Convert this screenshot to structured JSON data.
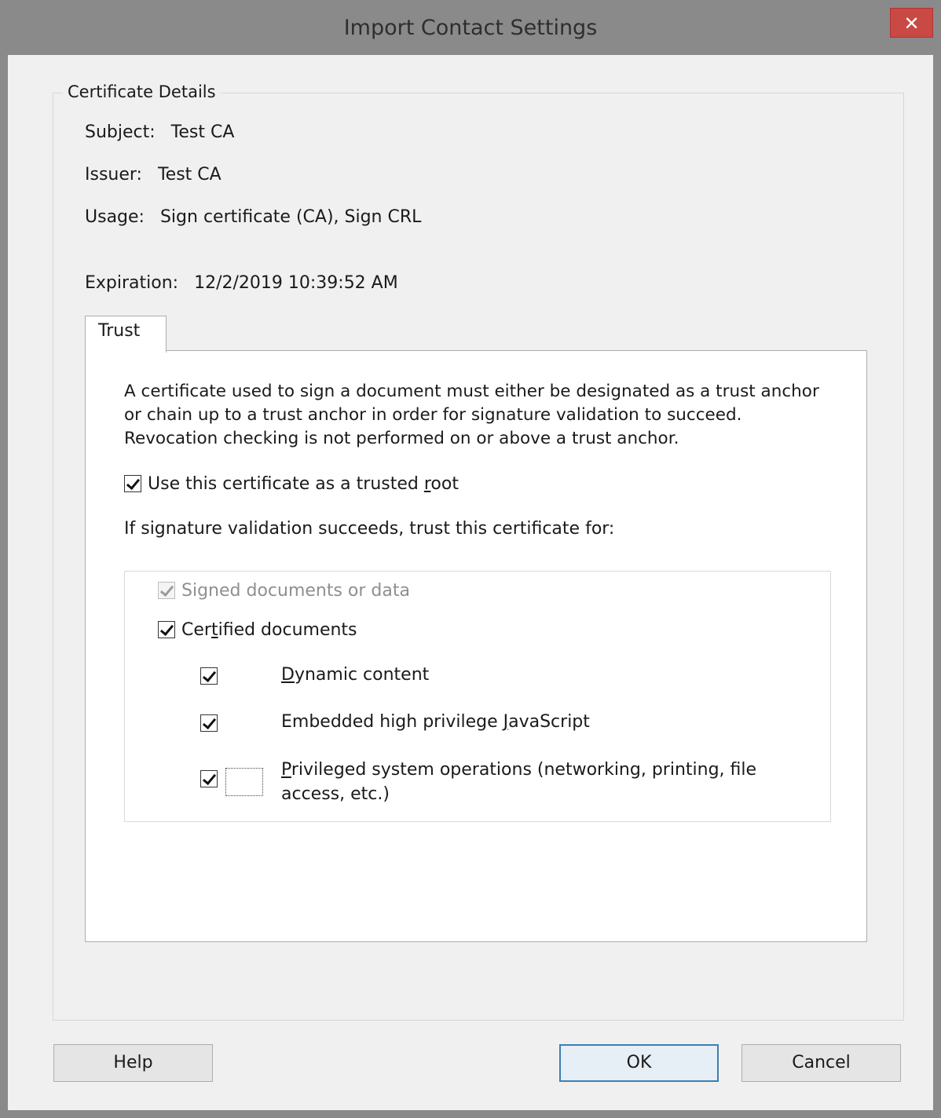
{
  "window": {
    "title": "Import Contact Settings",
    "close_glyph": "✕"
  },
  "group": {
    "title": "Certificate Details"
  },
  "details": {
    "subject_label": "Subject:",
    "subject_value": "Test CA",
    "issuer_label": "Issuer:",
    "issuer_value": "Test CA",
    "usage_label": "Usage:",
    "usage_value": "Sign certificate (CA), Sign CRL",
    "expiration_label": "Expiration:",
    "expiration_value": "12/2/2019 10:39:52 AM"
  },
  "tabs": [
    {
      "label": "Trust",
      "selected": true
    }
  ],
  "trust": {
    "description": "A certificate used to sign a document must either be designated as a trust anchor or chain up to a trust anchor in order for signature validation to succeed.  Revocation checking is not performed on or above a trust anchor.",
    "use_as_root": {
      "label_pre": "Use this certificate as a trusted ",
      "label_access": "r",
      "label_post": "oot",
      "checked": true
    },
    "trust_for_label": "If signature validation succeeds, trust this certificate for:",
    "options": {
      "signed_docs": {
        "label": "Signed documents or data",
        "checked": true,
        "enabled": false
      },
      "certified_docs": {
        "label_pre": "Cer",
        "label_access": "t",
        "label_post": "ified documents",
        "checked": true,
        "enabled": true
      },
      "dynamic_content": {
        "label_access": "D",
        "label_post": "ynamic content",
        "checked": true
      },
      "embedded_js": {
        "label_pre": "Embedded high privilege ",
        "label_access": "J",
        "label_post": "avaScript",
        "checked": true
      },
      "privileged_ops": {
        "label_access": "P",
        "label_post": "rivileged system operations (networking, printing, file",
        "label_line2": "access, etc.)",
        "checked": true
      }
    }
  },
  "buttons": {
    "help": "Help",
    "ok": "OK",
    "cancel": "Cancel"
  },
  "colors": {
    "titlebar": "#8a8a8a",
    "close": "#c94a45",
    "client": "#f0f0f0",
    "default_button_border": "#3c7fb1"
  },
  "icons": {
    "close": "close-icon",
    "check": "checkmark-icon"
  }
}
